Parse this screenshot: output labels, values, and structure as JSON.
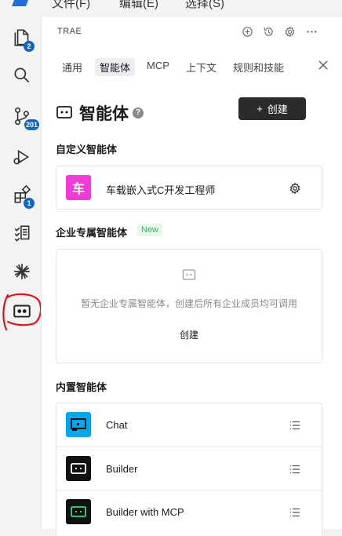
{
  "menubar": {
    "items": [
      "文件(F)",
      "编辑(E)",
      "选择(S)"
    ]
  },
  "activity_bar": {
    "badges": {
      "explorer": "2",
      "source_control": "201",
      "extensions": "1"
    }
  },
  "panel": {
    "title": "TRAE",
    "tabs": [
      "通用",
      "智能体",
      "MCP",
      "上下文",
      "规则和技能"
    ],
    "active_tab": "智能体"
  },
  "agents_page": {
    "heading": "智能体",
    "help": "?",
    "create_button": {
      "plus": "+",
      "label": "创建"
    },
    "custom_section": {
      "label": "自定义智能体",
      "items": [
        {
          "avatar_char": "车",
          "name": "车载嵌入式C开发工程师",
          "avatar_color": "#f03bd6"
        }
      ]
    },
    "enterprise_section": {
      "label": "企业专属智能体",
      "tag": "New",
      "empty_text": "暂无企业专属智能体，创建后所有企业成员均可调用",
      "empty_create_label": "创建"
    },
    "builtin_section": {
      "label": "内置智能体",
      "items": [
        {
          "name": "Chat",
          "avatar_color": "#00a6f0"
        },
        {
          "name": "Builder",
          "avatar_color": "#111111"
        },
        {
          "name": "Builder with MCP",
          "avatar_color": "#111111"
        }
      ]
    }
  },
  "colors": {
    "accent_dark": "#2b2b2b",
    "badge_blue": "#1565c0",
    "annotation_red": "#e0141e",
    "new_tag_green": "#3bb36a"
  }
}
